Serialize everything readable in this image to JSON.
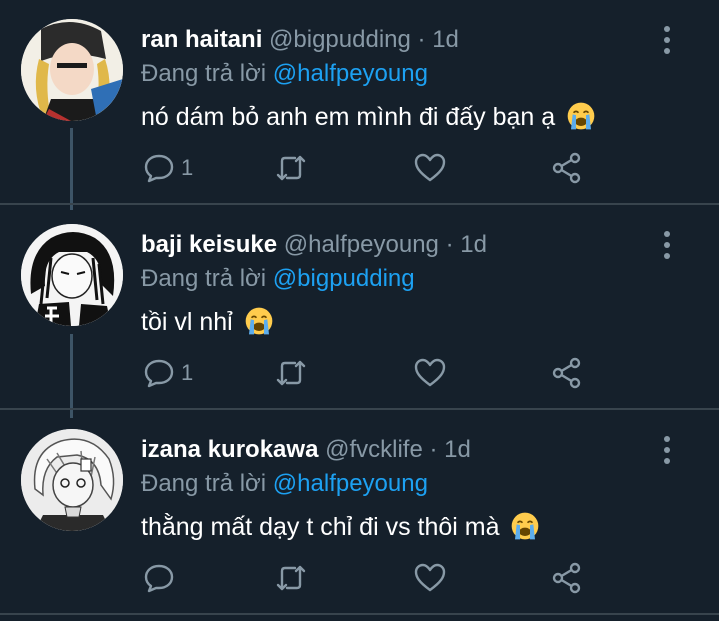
{
  "tweets": [
    {
      "name": "ran haitani",
      "handle": "@bigpudding",
      "time": "1d",
      "reply_prefix": "Đang trả lời",
      "reply_to": "@halfpeyoung",
      "text": "nó dám bỏ anh em mình đi đấy bạn ạ",
      "emoji": "loudly-crying-face",
      "reply_count": "1"
    },
    {
      "name": "baji keisuke",
      "handle": "@halfpeyoung",
      "time": "1d",
      "reply_prefix": "Đang trả lời",
      "reply_to": "@bigpudding",
      "text": "tồi vl nhỉ",
      "emoji": "loudly-crying-face",
      "reply_count": "1"
    },
    {
      "name": "izana kurokawa",
      "handle": "@fvcklife",
      "time": "1d",
      "reply_prefix": "Đang trả lời",
      "reply_to": "@halfpeyoung",
      "text": "thằng mất dạy t chỉ đi vs thôi mà",
      "emoji": "loudly-crying-face",
      "reply_count": ""
    }
  ],
  "icons": {
    "reply": "reply-icon",
    "retweet": "retweet-icon",
    "like": "heart-icon",
    "share": "share-icon",
    "more": "more-vertical-icon"
  },
  "colors": {
    "background": "#15202b",
    "secondary_text": "#8899a6",
    "link": "#1da1f2",
    "divider": "#38444d"
  }
}
